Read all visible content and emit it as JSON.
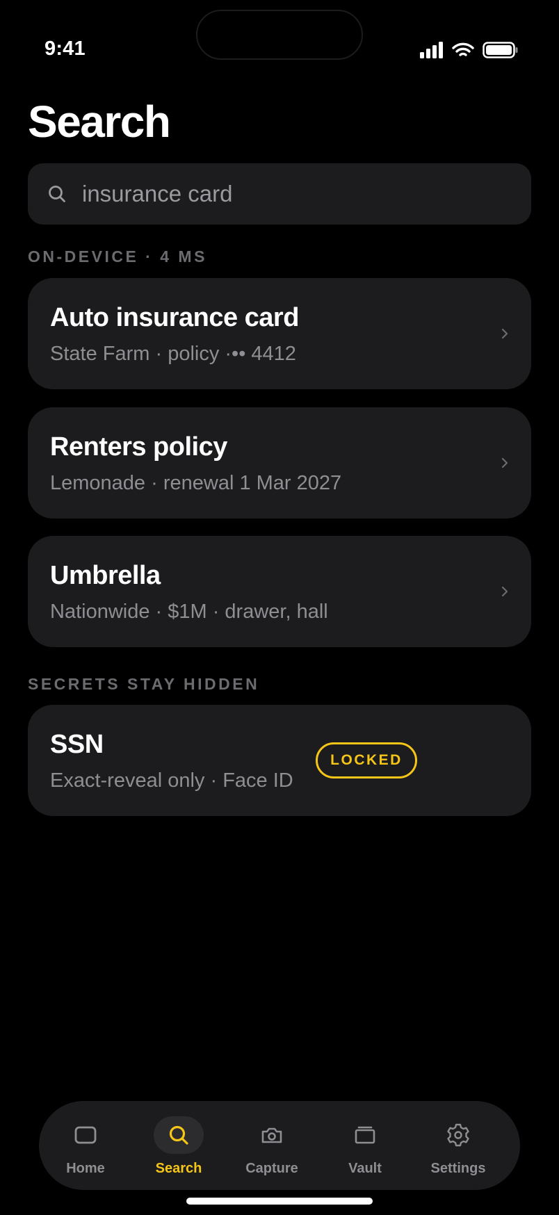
{
  "status_bar": {
    "time": "9:41"
  },
  "page": {
    "title": "Search"
  },
  "search": {
    "query": "insurance card"
  },
  "sections": {
    "results_label": "ON-DEVICE · 4 MS",
    "secrets_label": "SECRETS STAY HIDDEN"
  },
  "results": [
    {
      "title": "Auto insurance card",
      "subtitle": "State Farm · policy ·•• 4412"
    },
    {
      "title": "Renters policy",
      "subtitle": "Lemonade · renewal 1 Mar 2027"
    },
    {
      "title": "Umbrella",
      "subtitle": "Nationwide · $1M · drawer, hall"
    }
  ],
  "secret": {
    "title": "SSN",
    "subtitle": "Exact-reveal only · Face ID",
    "badge": "LOCKED"
  },
  "tabs": [
    {
      "label": "Home",
      "icon": "home-icon",
      "active": false
    },
    {
      "label": "Search",
      "icon": "search-icon",
      "active": true
    },
    {
      "label": "Capture",
      "icon": "camera-icon",
      "active": false
    },
    {
      "label": "Vault",
      "icon": "vault-icon",
      "active": false
    },
    {
      "label": "Settings",
      "icon": "gear-icon",
      "active": false
    }
  ],
  "colors": {
    "accent": "#f5c518",
    "card": "#1c1c1e",
    "background": "#000000",
    "muted": "#8e8e93"
  }
}
